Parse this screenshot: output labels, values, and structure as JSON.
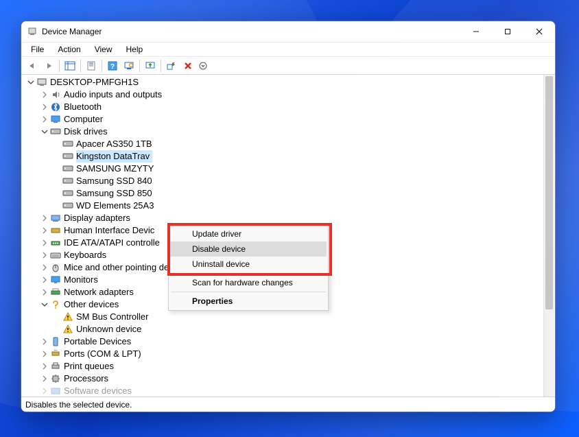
{
  "window": {
    "title": "Device Manager"
  },
  "menubar": {
    "items": [
      "File",
      "Action",
      "View",
      "Help"
    ]
  },
  "toolbar": {
    "back": "back-arrow",
    "forward": "forward-arrow",
    "showhide": "show-hide",
    "properties": "properties",
    "help": "help",
    "refresh": "refresh",
    "scan": "scan-hardware",
    "update": "update-driver",
    "uninstall": "uninstall",
    "disable": "disable",
    "views": "views"
  },
  "tree": {
    "root": {
      "label": "DESKTOP-PMFGH1S",
      "expanded": true
    },
    "items": [
      {
        "label": "Audio inputs and outputs",
        "icon": "audio",
        "expanded": false,
        "children": false,
        "expander": true
      },
      {
        "label": "Bluetooth",
        "icon": "bluetooth",
        "expanded": false,
        "children": false,
        "expander": true
      },
      {
        "label": "Computer",
        "icon": "computer",
        "expanded": false,
        "children": false,
        "expander": true
      },
      {
        "label": "Disk drives",
        "icon": "disk",
        "expanded": true,
        "children": true
      }
    ],
    "diskDrives": [
      {
        "label": "Apacer AS350 1TB",
        "icon": "disk"
      },
      {
        "label": "Kingston DataTrav",
        "icon": "disk",
        "selected": true
      },
      {
        "label": "SAMSUNG MZYTY",
        "icon": "disk"
      },
      {
        "label": "Samsung SSD 840",
        "icon": "disk"
      },
      {
        "label": "Samsung SSD 850",
        "icon": "disk"
      },
      {
        "label": "WD Elements 25A3",
        "icon": "disk"
      }
    ],
    "itemsAfter": [
      {
        "label": "Display adapters",
        "icon": "display",
        "expander": true
      },
      {
        "label": "Human Interface Devic",
        "icon": "hid",
        "expander": true
      },
      {
        "label": "IDE ATA/ATAPI controlle",
        "icon": "ide",
        "expander": true
      },
      {
        "label": "Keyboards",
        "icon": "keyboard",
        "expander": true
      },
      {
        "label": "Mice and other pointing devices",
        "icon": "mouse",
        "expander": true
      },
      {
        "label": "Monitors",
        "icon": "monitor",
        "expander": true
      },
      {
        "label": "Network adapters",
        "icon": "network",
        "expander": true
      },
      {
        "label": "Other devices",
        "icon": "other",
        "expanded": true,
        "children": true
      }
    ],
    "otherDevices": [
      {
        "label": "SM Bus Controller",
        "icon": "warning"
      },
      {
        "label": "Unknown device",
        "icon": "warning"
      }
    ],
    "itemsTail": [
      {
        "label": "Portable Devices",
        "icon": "portable",
        "expander": true
      },
      {
        "label": "Ports (COM & LPT)",
        "icon": "ports",
        "expander": true
      },
      {
        "label": "Print queues",
        "icon": "print",
        "expander": true
      },
      {
        "label": "Processors",
        "icon": "cpu",
        "expander": true
      },
      {
        "label": "Software devices",
        "icon": "software",
        "expander": true
      }
    ]
  },
  "contextMenu": {
    "updateDriver": "Update driver",
    "disableDevice": "Disable device",
    "uninstallDevice": "Uninstall device",
    "scanHardware": "Scan for hardware changes",
    "properties": "Properties",
    "hoveredItem": "disableDevice"
  },
  "statusbar": {
    "text": "Disables the selected device."
  }
}
